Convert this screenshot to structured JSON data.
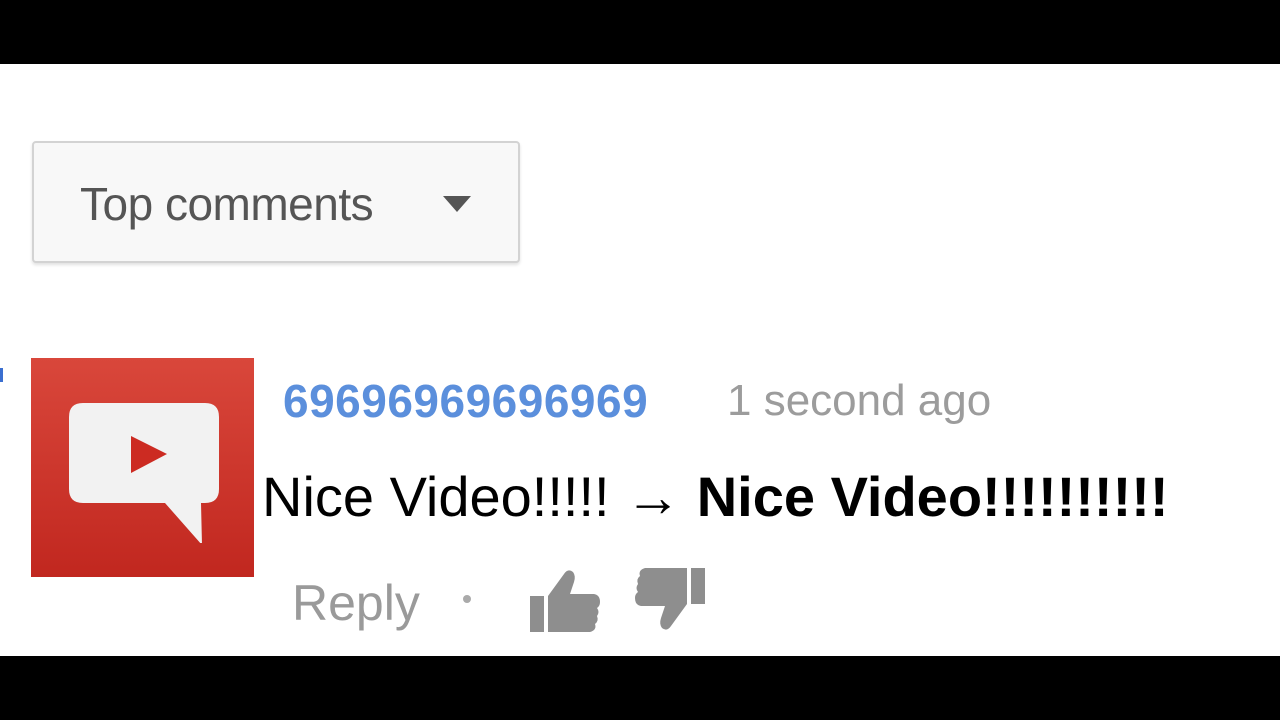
{
  "sort_menu": {
    "label": "Top comments",
    "caret_icon": "caret-down-icon"
  },
  "comment": {
    "avatar_icon": "youtube-chat-bubble-icon",
    "author": "69696969696969",
    "timestamp": "1 second ago",
    "text_original": "Nice Video!!!!!",
    "arrow": "→",
    "text_edited": "Nice Video!!!!!!!!!!",
    "actions": {
      "reply_label": "Reply",
      "like_icon": "thumbs-up-icon",
      "dislike_icon": "thumbs-down-icon"
    }
  },
  "colors": {
    "author_link": "#5b8fdc",
    "avatar_red": "#c9302c",
    "muted_text": "#9c9c9c"
  }
}
